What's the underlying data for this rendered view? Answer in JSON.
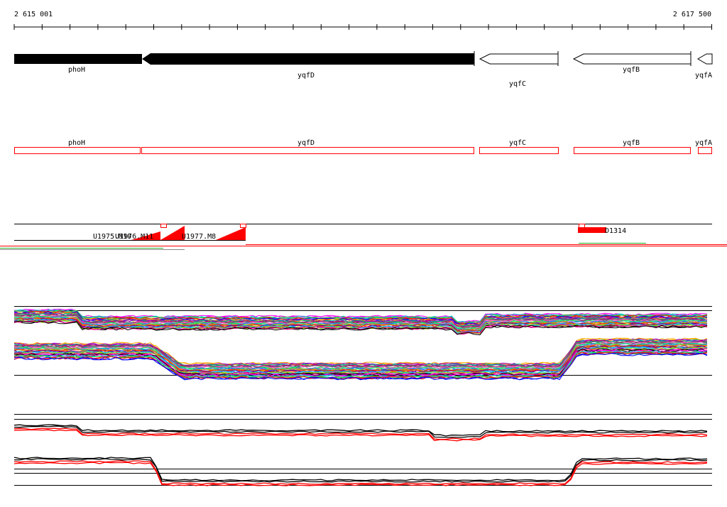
{
  "ruler": {
    "start_label": "2 615 001",
    "end_label": "2 617 500"
  },
  "genes_track": {
    "genes": [
      {
        "id": "phoH",
        "label": "phoH",
        "strand": "+",
        "style": "filled"
      },
      {
        "id": "yqfD",
        "label": "yqfD",
        "strand": "-",
        "style": "filled"
      },
      {
        "id": "yqfC",
        "label": "yqfC",
        "strand": "-",
        "style": "outline"
      },
      {
        "id": "yqfB",
        "label": "yqfB",
        "strand": "-",
        "style": "outline"
      },
      {
        "id": "yqfA",
        "label": "yqfA",
        "strand": "-",
        "style": "outline"
      }
    ]
  },
  "annotation_track": {
    "boxes": [
      {
        "id": "phoH",
        "label": "phoH"
      },
      {
        "id": "yqfD",
        "label": "yqfD"
      },
      {
        "id": "yqfC",
        "label": "yqfC"
      },
      {
        "id": "yqfB",
        "label": "yqfB"
      },
      {
        "id": "yqfA",
        "label": "yqfA"
      }
    ],
    "box_color": "#ff0000"
  },
  "features_track": {
    "labels": {
      "u1975": "U1975.M10",
      "u1976": "U1976.M11",
      "u1977": "U1977.M8",
      "d1314": "D1314"
    },
    "feature_color": "#ff0000"
  },
  "colors": {
    "gene_fill": "#000000",
    "annotation": "#ff0000",
    "green": "#00aa00"
  }
}
